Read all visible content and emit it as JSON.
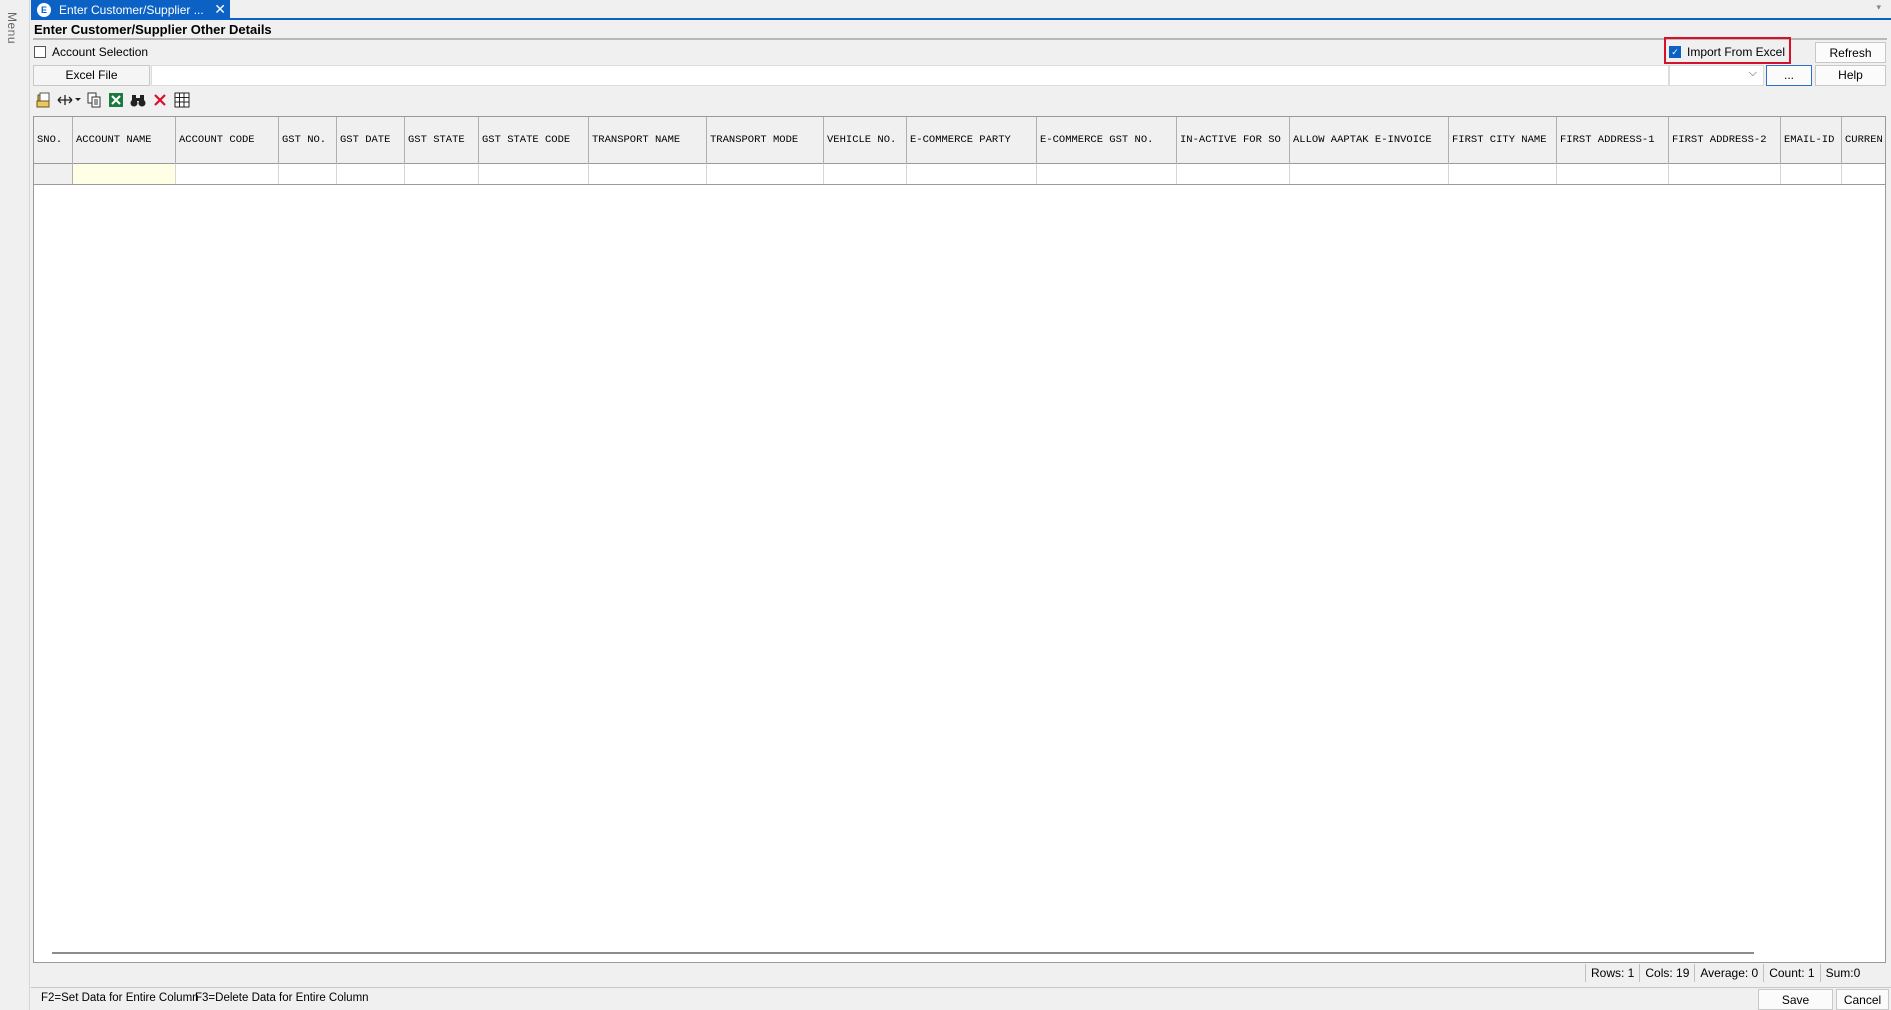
{
  "menu_label": "Menu",
  "tab": {
    "title": "Enter Customer/Supplier ...",
    "close_glyph": "✕",
    "app_icon_glyph": "E"
  },
  "form_title": "Enter Customer/Supplier Other Details",
  "account_selection": {
    "label": "Account Selection",
    "checked": false
  },
  "import_from_excel": {
    "label": "Import From Excel",
    "checked": true
  },
  "buttons": {
    "refresh": "Refresh",
    "browse": "...",
    "help": "Help",
    "save": "Save",
    "cancel": "Cancel"
  },
  "excel_file": {
    "label": "Excel File",
    "value": ""
  },
  "toolbar_icons": [
    "open-icon",
    "column-resize-icon",
    "copy-icon",
    "excel-export-icon",
    "find-icon",
    "delete-icon",
    "grid-icon"
  ],
  "grid": {
    "columns": [
      "SNO.",
      "ACCOUNT NAME",
      "ACCOUNT CODE",
      "GST NO.",
      "GST DATE",
      "GST STATE",
      "GST STATE CODE",
      "TRANSPORT NAME",
      "TRANSPORT MODE",
      "VEHICLE NO.",
      "E-COMMERCE PARTY",
      "E-COMMERCE GST NO.",
      "IN-ACTIVE FOR SO",
      "ALLOW AAPTAK E-INVOICE",
      "FIRST CITY NAME",
      "FIRST ADDRESS-1",
      "FIRST ADDRESS-2",
      "EMAIL-ID",
      "CURREN"
    ],
    "rows": [
      [
        "",
        "",
        "",
        "",
        "",
        "",
        "",
        "",
        "",
        "",
        "",
        "",
        "",
        "",
        "",
        "",
        "",
        "",
        ""
      ]
    ]
  },
  "status": {
    "rows": "Rows: 1",
    "cols": "Cols: 19",
    "average": "Average: 0",
    "count": "Count: 1",
    "sum": "Sum:0"
  },
  "hints": {
    "f2": "F2=Set Data for Entire Column",
    "f3": "F3=Delete Data for Entire Column"
  },
  "colors": {
    "accent": "#0b62c4",
    "highlight_border": "#d8102a",
    "active_cell": "#ffffe6"
  }
}
